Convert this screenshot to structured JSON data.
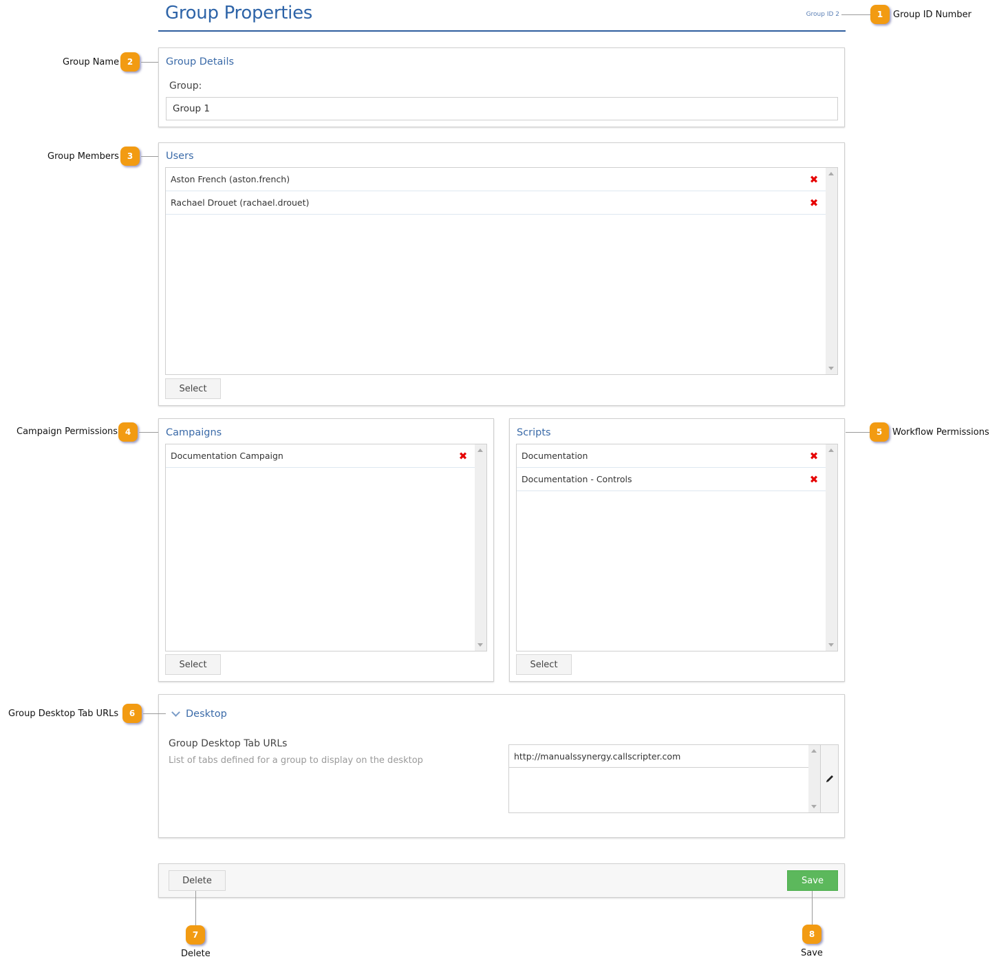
{
  "header": {
    "title": "Group Properties",
    "group_id": "Group ID 2"
  },
  "group_details": {
    "title": "Group Details",
    "group_label": "Group:",
    "group_value": "Group 1"
  },
  "users": {
    "title": "Users",
    "items": [
      {
        "label": "Aston French (aston.french)"
      },
      {
        "label": "Rachael Drouet (rachael.drouet)"
      }
    ],
    "select_label": "Select",
    "remove_icon": "✖"
  },
  "campaigns": {
    "title": "Campaigns",
    "items": [
      {
        "label": "Documentation Campaign"
      }
    ],
    "select_label": "Select",
    "remove_icon": "✖"
  },
  "scripts": {
    "title": "Scripts",
    "items": [
      {
        "label": "Documentation"
      },
      {
        "label": "Documentation - Controls"
      }
    ],
    "select_label": "Select",
    "remove_icon": "✖"
  },
  "desktop": {
    "title": "Desktop",
    "field_label": "Group Desktop Tab URLs",
    "field_description": "List of tabs defined for a group to display on the desktop",
    "urls": [
      "http://manualssynergy.callscripter.com"
    ],
    "edit_icon": "pencil-icon"
  },
  "footer": {
    "delete_label": "Delete",
    "save_label": "Save",
    "save_color": "#5cb85c"
  },
  "callouts": [
    {
      "number": "1",
      "label": "Group ID Number"
    },
    {
      "number": "2",
      "label": "Group Name"
    },
    {
      "number": "3",
      "label": "Group Members"
    },
    {
      "number": "4",
      "label": "Campaign Permissions"
    },
    {
      "number": "5",
      "label": "Workflow Permissions"
    },
    {
      "number": "6",
      "label": "Group Desktop Tab URLs"
    },
    {
      "number": "7",
      "label": "Delete"
    },
    {
      "number": "8",
      "label": "Save"
    }
  ],
  "colors": {
    "accent": "#2e64a8",
    "callout": "#f29b12",
    "remove": "#e60000"
  }
}
